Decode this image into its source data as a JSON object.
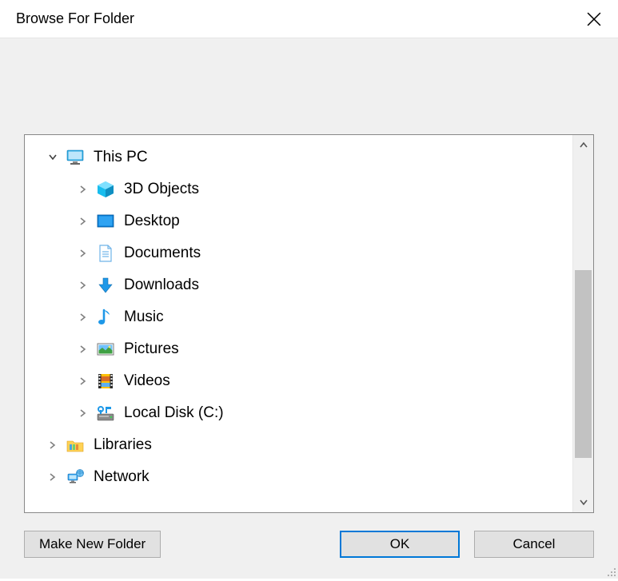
{
  "title": "Browse For Folder",
  "tree": {
    "this_pc": {
      "label": "This PC"
    },
    "objects3d": {
      "label": "3D Objects"
    },
    "desktop": {
      "label": "Desktop"
    },
    "documents": {
      "label": "Documents"
    },
    "downloads": {
      "label": "Downloads"
    },
    "music": {
      "label": "Music"
    },
    "pictures": {
      "label": "Pictures"
    },
    "videos": {
      "label": "Videos"
    },
    "local_disk": {
      "label": "Local Disk (C:)"
    },
    "libraries": {
      "label": "Libraries"
    },
    "network": {
      "label": "Network"
    }
  },
  "buttons": {
    "make_new_folder": "Make New Folder",
    "ok": "OK",
    "cancel": "Cancel"
  }
}
